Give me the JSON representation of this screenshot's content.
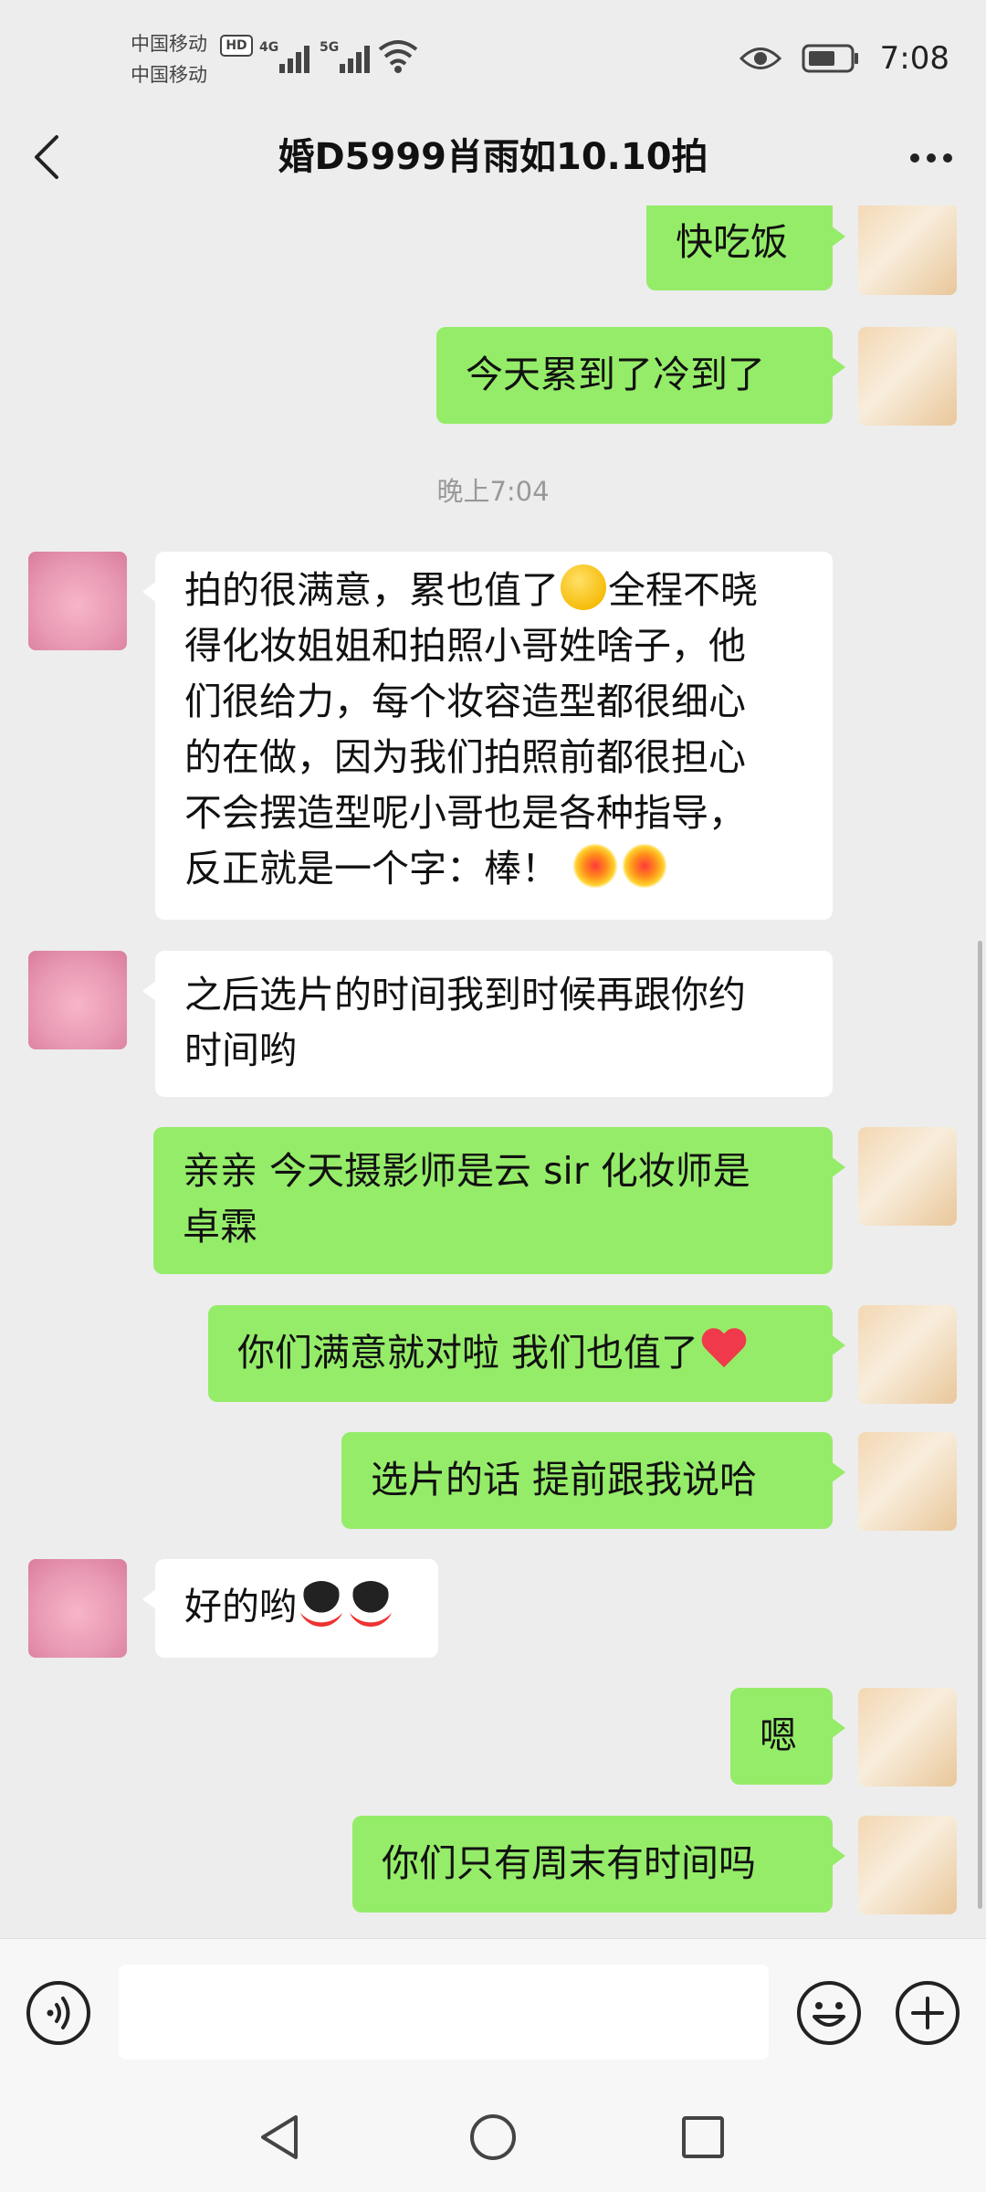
{
  "status_bar": {
    "carrier_1": "中国移动",
    "carrier_2": "中国移动",
    "hd_badge": "HD",
    "net_1": "4G",
    "net_2": "5G",
    "time": "7:08"
  },
  "header": {
    "title": "婚D5999肖雨如10.10拍"
  },
  "chat": {
    "timestamp": "晚上7:04",
    "messages": [
      {
        "side": "mine",
        "text": "快吃饭"
      },
      {
        "side": "mine",
        "text": "今天累到了冷到了"
      },
      {
        "side": "theirs",
        "text_a": "拍的很满意，累也值了",
        "text_b": "全程不晓\n得化妆姐姐和拍照小哥姓啥子，他\n们很给力，每个妆容造型都很细心\n的在做，因为我们拍照前都很担心\n不会摆造型呢小哥也是各种指导，\n反正就是一个字：棒！ "
      },
      {
        "side": "theirs",
        "text": "之后选片的时间我到时候再跟你约\n时间哟"
      },
      {
        "side": "mine",
        "text": "亲亲 今天摄影师是云 sir 化妆师是\n卓霖"
      },
      {
        "side": "mine",
        "text": "你们满意就对啦 我们也值了"
      },
      {
        "side": "mine",
        "text": "选片的话 提前跟我说哈"
      },
      {
        "side": "theirs",
        "text": "好的哟"
      },
      {
        "side": "mine",
        "text": "嗯"
      },
      {
        "side": "mine",
        "text": "你们只有周末有时间吗"
      }
    ]
  },
  "input_bar": {
    "placeholder": ""
  },
  "icons": {
    "emoji_wink": "wink-emoji",
    "emoji_firework": "firework-emoji",
    "emoji_heart": "red-heart-emoji",
    "emoji_penguin": "qq-penguin-emoji"
  },
  "colors": {
    "my_bubble": "#95ec69",
    "their_bubble": "#ffffff",
    "background": "#ededed"
  }
}
